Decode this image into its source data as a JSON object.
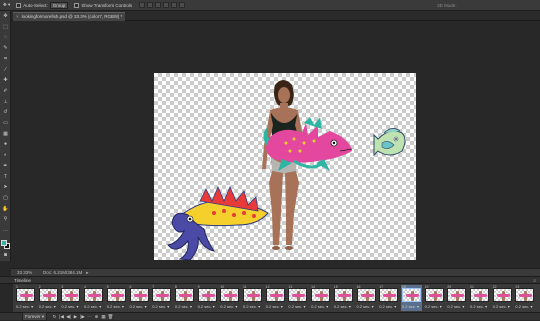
{
  "options_bar": {
    "auto_select_label": "Auto-Select:",
    "auto_select_value": "Group",
    "show_transform_label": "Show Transform Controls",
    "mode_3d_label": "3D Mode:"
  },
  "document_tab": {
    "title": "lookingformorefish.psd @ 33.3% (color7, RGB/8) *",
    "close_glyph": "×"
  },
  "tools": [
    {
      "icon": "move-tool-icon",
      "glyph": "✥"
    },
    {
      "icon": "marquee-tool-icon",
      "glyph": "⬚"
    },
    {
      "icon": "lasso-tool-icon",
      "glyph": "◌"
    },
    {
      "icon": "quick-select-tool-icon",
      "glyph": "✎"
    },
    {
      "icon": "crop-tool-icon",
      "glyph": "⌗"
    },
    {
      "icon": "eyedropper-tool-icon",
      "glyph": "⁄"
    },
    {
      "icon": "healing-brush-tool-icon",
      "glyph": "✚"
    },
    {
      "icon": "brush-tool-icon",
      "glyph": "✐"
    },
    {
      "icon": "clone-stamp-tool-icon",
      "glyph": "⊥"
    },
    {
      "icon": "history-brush-tool-icon",
      "glyph": "↺"
    },
    {
      "icon": "eraser-tool-icon",
      "glyph": "▭"
    },
    {
      "icon": "gradient-tool-icon",
      "glyph": "▦"
    },
    {
      "icon": "blur-tool-icon",
      "glyph": "●"
    },
    {
      "icon": "dodge-tool-icon",
      "glyph": "◐"
    },
    {
      "icon": "pen-tool-icon",
      "glyph": "✒"
    },
    {
      "icon": "type-tool-icon",
      "glyph": "T"
    },
    {
      "icon": "path-select-tool-icon",
      "glyph": "➤"
    },
    {
      "icon": "shape-tool-icon",
      "glyph": "▢"
    },
    {
      "icon": "hand-tool-icon",
      "glyph": "✋"
    },
    {
      "icon": "zoom-tool-icon",
      "glyph": "⚲"
    },
    {
      "icon": "more-tools-icon",
      "glyph": "…"
    }
  ],
  "colors": {
    "foreground": "#3aaea2",
    "background": "#111111"
  },
  "status_bar": {
    "zoom": "33.33%",
    "doc_info": "Doc: 6.21M/384.1M",
    "arrow": "▸"
  },
  "timeline": {
    "panel_title": "Timeline",
    "menu_glyph": "≡",
    "frames": [
      {
        "number": "1",
        "duration": "0.2 sec. ▾"
      },
      {
        "number": "2",
        "duration": "0.2 sec. ▾"
      },
      {
        "number": "3",
        "duration": "0.2 sec. ▾"
      },
      {
        "number": "4",
        "duration": "0.2 sec. ▾"
      },
      {
        "number": "5",
        "duration": "0.2 sec. ▾"
      },
      {
        "number": "6",
        "duration": "0.2 sec. ▾"
      },
      {
        "number": "7",
        "duration": "0.2 sec. ▾"
      },
      {
        "number": "8",
        "duration": "0.2 sec. ▾"
      },
      {
        "number": "9",
        "duration": "0.2 sec. ▾"
      },
      {
        "number": "10",
        "duration": "0.2 sec. ▾"
      },
      {
        "number": "11",
        "duration": "0.2 sec. ▾"
      },
      {
        "number": "12",
        "duration": "0.2 sec. ▾"
      },
      {
        "number": "13",
        "duration": "0.2 sec. ▾"
      },
      {
        "number": "14",
        "duration": "0.2 sec. ▾"
      },
      {
        "number": "15",
        "duration": "0.2 sec. ▾"
      },
      {
        "number": "16",
        "duration": "0.2 sec. ▾"
      },
      {
        "number": "17",
        "duration": "0.2 sec. ▾"
      },
      {
        "number": "18",
        "duration": "0.2 sec. ▾"
      },
      {
        "number": "19",
        "duration": "0.2 sec. ▾"
      },
      {
        "number": "20",
        "duration": "0.2 sec. ▾"
      },
      {
        "number": "21",
        "duration": "0.2 sec. ▾"
      },
      {
        "number": "22",
        "duration": "0.2 sec. ▾"
      },
      {
        "number": "23",
        "duration": "0.2 sec. ▾"
      }
    ],
    "selected_frame": 18,
    "loop_option": "Forever ▾",
    "transport": [
      "↻",
      "|◀",
      "◀|",
      "▶",
      "|▶",
      "⋯",
      "⊕",
      "▦",
      "🗑"
    ]
  }
}
